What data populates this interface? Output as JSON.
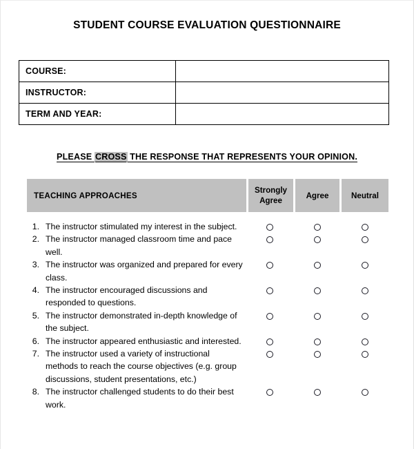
{
  "document": {
    "title": "STUDENT COURSE EVALUATION QUESTIONNAIRE",
    "info_table": {
      "rows": [
        {
          "label": "COURSE:",
          "value": ""
        },
        {
          "label": "INSTRUCTOR:",
          "value": ""
        },
        {
          "label": "TERM AND YEAR:",
          "value": ""
        }
      ]
    },
    "instruction": {
      "before": "PLEASE ",
      "highlight": "CROSS",
      "after": " THE RESPONSE THAT REPRESENTS YOUR OPINION.",
      "highlight_color": "#bfbfbf"
    },
    "section": {
      "header_label": "TEACHING APPROACHES",
      "header_background": "#c0c0c0",
      "columns": [
        {
          "label": "Strongly Agree"
        },
        {
          "label": "Agree"
        },
        {
          "label": "Neutral"
        }
      ]
    },
    "questions": [
      {
        "number": "1.",
        "text": "The instructor stimulated my interest in the subject."
      },
      {
        "number": "2.",
        "text": "The instructor managed classroom time and pace well."
      },
      {
        "number": "3.",
        "text": "The instructor was organized and prepared for every class."
      },
      {
        "number": "4.",
        "text": "The instructor encouraged discussions and responded to questions."
      },
      {
        "number": "5.",
        "text": "The instructor demonstrated in-depth knowledge of the subject."
      },
      {
        "number": "6.",
        "text": "The instructor appeared enthusiastic and interested."
      },
      {
        "number": "7.",
        "text": "The instructor used a variety of instructional methods to reach the course objectives (e.g. group discussions, student presentations, etc.)"
      },
      {
        "number": "8.",
        "text": "The instructor challenged students to do their best work."
      }
    ]
  }
}
